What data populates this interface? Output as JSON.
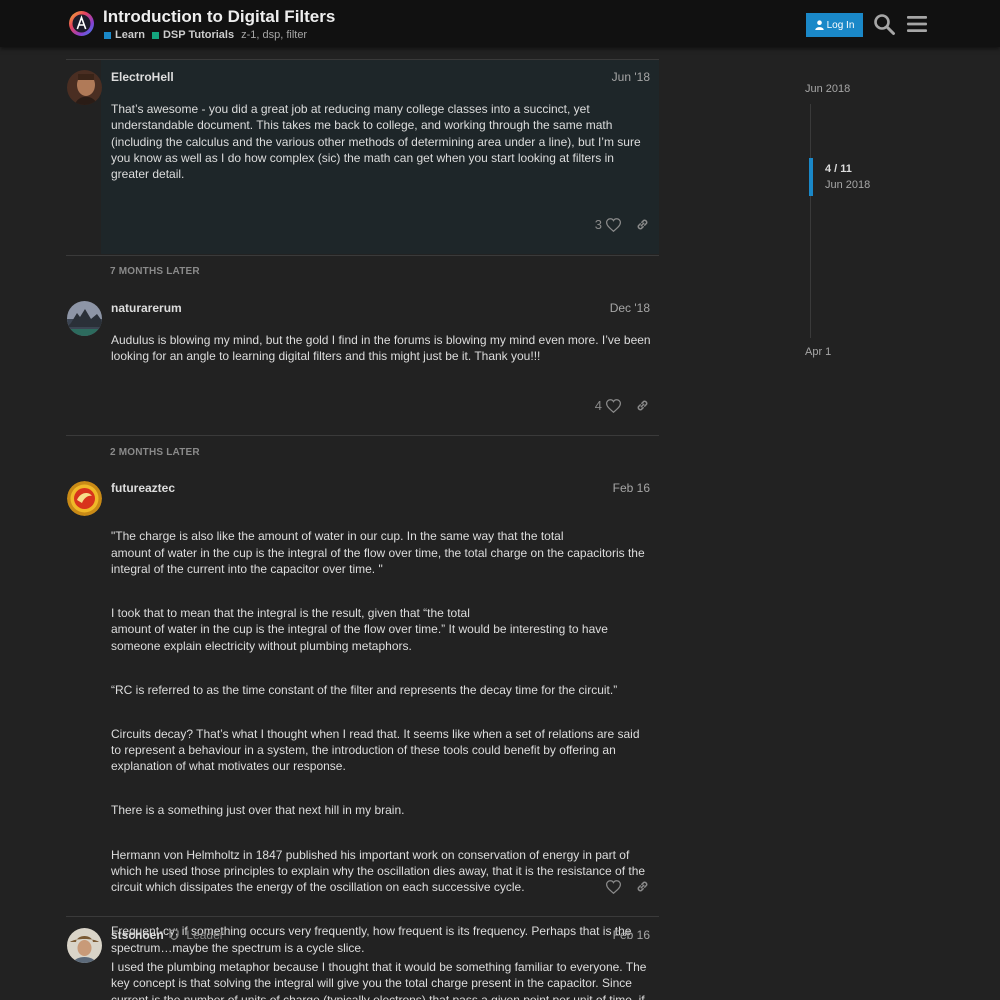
{
  "header": {
    "title": "Introduction to Digital Filters",
    "categories": [
      {
        "label": "Learn",
        "color": "#1a88c8"
      },
      {
        "label": "DSP Tutorials",
        "color": "#14a57e"
      }
    ],
    "tags": "z-1, dsp, filter",
    "login_label": "Log In",
    "icons": [
      "audulus-logo-icon",
      "person-icon",
      "search-icon",
      "hamburger-menu-icon"
    ]
  },
  "posts": [
    {
      "username": "ElectroHell",
      "date": "Jun '18",
      "paragraphs": [
        "That’s awesome - you did a great job at reducing many college classes into a succinct, yet understandable document. This takes me back to college, and working through the same math (including the calculus and the various other methods of determining area under a line), but I’m sure you know as well as I do how complex (sic) the math can get when you start looking at filters in greater detail."
      ],
      "likes": "3"
    },
    {
      "username": "naturarerum",
      "date": "Dec '18",
      "paragraphs": [
        "Audulus is blowing my mind, but the gold I find in the forums is blowing my mind even more. I’ve been looking for an angle to learning digital filters and this might just be it. Thank you!!!"
      ],
      "likes": "4"
    },
    {
      "username": "futureaztec",
      "date": "Feb 16",
      "paragraphs": [
        "\"The charge is also like the amount of water in our cup. In the same way that the total\namount of water in the cup is the integral of the flow over time, the total charge on the capacitoris the integral of the current into the capacitor over time. \"",
        "I took that to mean that the integral is the result, given that “the total\namount of water in the cup is the integral of the flow over time.” It would be interesting to have someone explain electricity without plumbing metaphors.",
        "“RC is referred to as the time constant of the filter and represents the decay time for the circuit.”",
        "Circuits decay? That’s what I thought when I read that. It seems like when a set of relations are said to represent a behaviour in a system, the introduction of these tools could benefit by offering an explanation of what motivates our response.",
        "There is a something just over that next hill in my brain.",
        "Hermann von Helmholtz in 1847 published his important work on conservation of energy in part of which he used those principles to explain why the oscillation dies away, that it is the resistance of the circuit which dissipates the energy of the oscillation on each successive cycle.",
        "Frequent-cy; if something occurs very frequently, how frequent is its frequency. Perhaps that is the spectrum…maybe the spectrum is a cycle slice."
      ],
      "likes": ""
    },
    {
      "username": "stschoen",
      "flair": "Leader",
      "date": "Feb 16",
      "paragraphs": [
        "I used the plumbing metaphor because I thought that it would be something familiar to everyone. The key concept is that solving the integral will give you the total charge present in the capacitor. Since current is the number of units of charge (typically electrons) that pass a given point per unit of time, if"
      ],
      "likes": ""
    }
  ],
  "gaps": [
    "7 MONTHS LATER",
    "2 MONTHS LATER"
  ],
  "timeline": {
    "start": "Jun 2018",
    "position": "4 / 11",
    "position_date": "Jun 2018",
    "end": "Apr 1"
  }
}
